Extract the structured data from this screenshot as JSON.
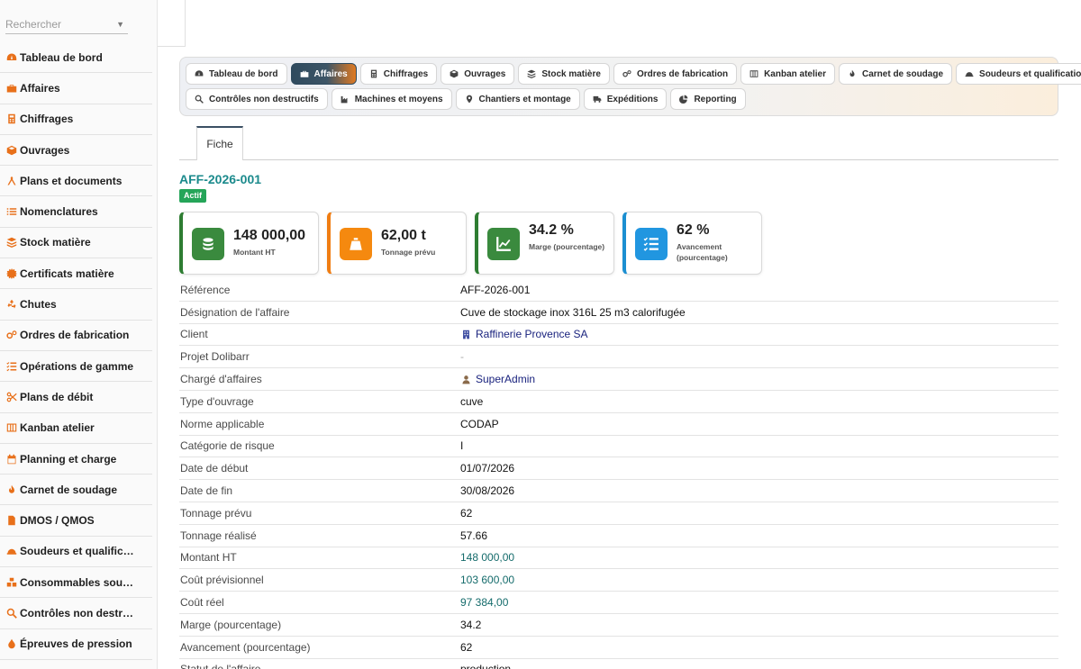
{
  "sidebar": {
    "search_placeholder": "Rechercher",
    "items": [
      {
        "label": "Tableau de bord",
        "icon": "tachometer-icon"
      },
      {
        "label": "Affaires",
        "icon": "briefcase-icon"
      },
      {
        "label": "Chiffrages",
        "icon": "calculator-icon"
      },
      {
        "label": "Ouvrages",
        "icon": "cube-icon"
      },
      {
        "label": "Plans et documents",
        "icon": "compass-icon"
      },
      {
        "label": "Nomenclatures",
        "icon": "list-icon"
      },
      {
        "label": "Stock matière",
        "icon": "layers-icon"
      },
      {
        "label": "Certificats matière",
        "icon": "certificate-icon"
      },
      {
        "label": "Chutes",
        "icon": "recycle-icon"
      },
      {
        "label": "Ordres de fabrication",
        "icon": "gears-icon"
      },
      {
        "label": "Opérations de gamme",
        "icon": "checklist-icon"
      },
      {
        "label": "Plans de débit",
        "icon": "scissors-icon"
      },
      {
        "label": "Kanban atelier",
        "icon": "kanban-icon"
      },
      {
        "label": "Planning et charge",
        "icon": "calendar-icon"
      },
      {
        "label": "Carnet de soudage",
        "icon": "flame-icon"
      },
      {
        "label": "DMOS / QMOS",
        "icon": "document-icon"
      },
      {
        "label": "Soudeurs et qualific…",
        "icon": "hardhat-icon"
      },
      {
        "label": "Consommables sou…",
        "icon": "boxes-icon"
      },
      {
        "label": "Contrôles non destr…",
        "icon": "search-icon"
      },
      {
        "label": "Épreuves de pression",
        "icon": "drop-icon"
      }
    ]
  },
  "modules": {
    "row1": [
      {
        "label": "Tableau de bord",
        "icon": "tachometer-icon",
        "active": false
      },
      {
        "label": "Affaires",
        "icon": "briefcase-icon",
        "active": true
      },
      {
        "label": "Chiffrages",
        "icon": "calculator-icon",
        "active": false
      },
      {
        "label": "Ouvrages",
        "icon": "cube-icon",
        "active": false
      },
      {
        "label": "Stock matière",
        "icon": "layers-icon",
        "active": false
      },
      {
        "label": "Ordres de fabrication",
        "icon": "gears-icon",
        "active": false
      },
      {
        "label": "Kanban atelier",
        "icon": "kanban-icon",
        "active": false
      },
      {
        "label": "Carnet de soudage",
        "icon": "flame-icon",
        "active": false
      },
      {
        "label": "Soudeurs et qualifications",
        "icon": "hardhat-icon",
        "active": false
      }
    ],
    "row2": [
      {
        "label": "Contrôles non destructifs",
        "icon": "search-icon",
        "active": false
      },
      {
        "label": "Machines et moyens",
        "icon": "industry-icon",
        "active": false
      },
      {
        "label": "Chantiers et montage",
        "icon": "map-pin-icon",
        "active": false
      },
      {
        "label": "Expéditions",
        "icon": "truck-icon",
        "active": false
      },
      {
        "label": "Reporting",
        "icon": "pie-chart-icon",
        "active": false
      }
    ]
  },
  "tabs": {
    "fiche": "Fiche"
  },
  "record": {
    "title": "AFF-2026-001",
    "status": "Actif"
  },
  "kpis": [
    {
      "value": "148 000,00",
      "label": "Montant HT",
      "icon": "coins-icon",
      "accent": "#2e7d32",
      "icon_bg": "#3a8a3e"
    },
    {
      "value": "62,00 t",
      "label": "Tonnage prévu",
      "icon": "weight-icon",
      "accent": "#f07d12",
      "icon_bg": "#f5890f"
    },
    {
      "value": "34.2 %",
      "label": "Marge (pourcentage)",
      "icon": "chart-line-icon",
      "accent": "#2e7d32",
      "icon_bg": "#3a8a3e"
    },
    {
      "value": "62 %",
      "label": "Avancement (pourcentage)",
      "icon": "tasks-icon",
      "accent": "#1b8fd1",
      "icon_bg": "#2196e0"
    }
  ],
  "details": [
    {
      "label": "Référence",
      "value": "AFF-2026-001",
      "kind": "text"
    },
    {
      "label": "Désignation de l'affaire",
      "value": "Cuve de stockage inox 316L 25 m3 calorifugée",
      "kind": "text"
    },
    {
      "label": "Client",
      "value": "Raffinerie Provence SA",
      "kind": "link",
      "icon": "building-icon"
    },
    {
      "label": "Projet Dolibarr",
      "value": "-",
      "kind": "muted"
    },
    {
      "label": "Chargé d'affaires",
      "value": "SuperAdmin",
      "kind": "link",
      "icon": "user-icon"
    },
    {
      "label": "Type d'ouvrage",
      "value": "cuve",
      "kind": "text"
    },
    {
      "label": "Norme applicable",
      "value": "CODAP",
      "kind": "text"
    },
    {
      "label": "Catégorie de risque",
      "value": "I",
      "kind": "text"
    },
    {
      "label": "Date de début",
      "value": "01/07/2026",
      "kind": "text"
    },
    {
      "label": "Date de fin",
      "value": "30/08/2026",
      "kind": "text"
    },
    {
      "label": "Tonnage prévu",
      "value": "62",
      "kind": "text"
    },
    {
      "label": "Tonnage réalisé",
      "value": "57.66",
      "kind": "text"
    },
    {
      "label": "Montant HT",
      "value": "148 000,00",
      "kind": "money"
    },
    {
      "label": "Coût prévisionnel",
      "value": "103 600,00",
      "kind": "money"
    },
    {
      "label": "Coût réel",
      "value": "97 384,00",
      "kind": "money"
    },
    {
      "label": "Marge (pourcentage)",
      "value": "34.2",
      "kind": "text"
    },
    {
      "label": "Avancement (pourcentage)",
      "value": "62",
      "kind": "text"
    },
    {
      "label": "Statut de l'affaire",
      "value": "production",
      "kind": "text"
    }
  ]
}
